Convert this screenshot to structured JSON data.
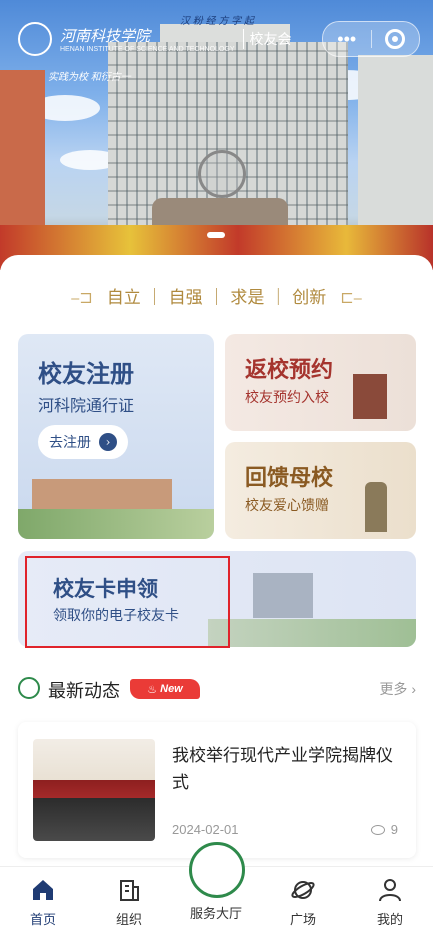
{
  "header": {
    "school_name": "河南科技学院",
    "school_name_en": "HENAN INSTITUTE OF SCIENCE AND TECHNOLOGY",
    "club_label": "校友会",
    "motto_script": "实践为校 和衍古一",
    "top_script": "汉 粉 经 方 字 起"
  },
  "motto": [
    "自立",
    "自强",
    "求是",
    "创新"
  ],
  "cards": {
    "register": {
      "title": "校友注册",
      "subtitle": "河科院通行证",
      "button": "去注册"
    },
    "return": {
      "title": "返校预约",
      "subtitle": "校友预约入校"
    },
    "feedback": {
      "title": "回馈母校",
      "subtitle": "校友爱心馈赠"
    },
    "alumni_card": {
      "title": "校友卡申领",
      "subtitle": "领取你的电子校友卡"
    }
  },
  "news": {
    "section_title": "最新动态",
    "badge": "New",
    "more": "更多",
    "items": [
      {
        "headline": "我校举行现代产业学院揭牌仪式",
        "date": "2024-02-01",
        "views": "9"
      }
    ]
  },
  "tabbar": {
    "items": [
      {
        "label": "首页",
        "icon": "home-icon"
      },
      {
        "label": "组织",
        "icon": "building-icon"
      },
      {
        "label": "服务大厅",
        "icon": "school-logo-icon"
      },
      {
        "label": "广场",
        "icon": "planet-icon"
      },
      {
        "label": "我的",
        "icon": "user-icon"
      }
    ]
  },
  "colors": {
    "accent": "#1f3b73",
    "gold": "#b08a3e",
    "badge_red": "#ea3b37",
    "highlight_red": "#e0232b"
  }
}
